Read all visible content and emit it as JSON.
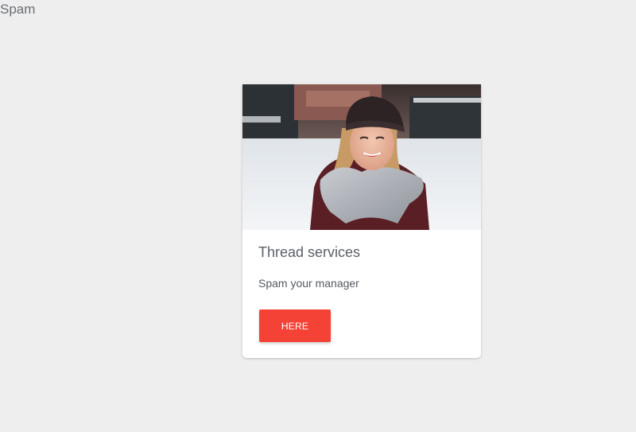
{
  "page": {
    "heading": "Spam"
  },
  "card": {
    "image_alt": "Smiling woman in a knit beanie and grey scarf outdoors in snow",
    "title": "Thread services",
    "text": "Spam your manager",
    "button_label": "HERE",
    "colors": {
      "button": "#f44336",
      "background": "#eeeeee",
      "card": "#ffffff"
    }
  }
}
